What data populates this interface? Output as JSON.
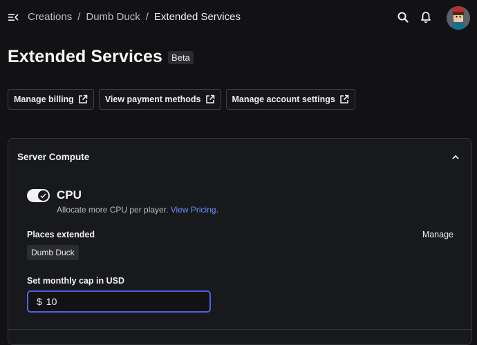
{
  "breadcrumb": {
    "items": [
      "Creations",
      "Dumb Duck",
      "Extended Services"
    ],
    "separator": "/"
  },
  "header": {
    "title": "Extended Services",
    "badge": "Beta"
  },
  "actions": [
    {
      "label": "Manage billing",
      "icon": "external-link-icon"
    },
    {
      "label": "View payment methods",
      "icon": "external-link-icon"
    },
    {
      "label": "Manage account settings",
      "icon": "external-link-icon"
    }
  ],
  "server_compute": {
    "title": "Server Compute",
    "cpu": {
      "title": "CPU",
      "enabled": true,
      "description": "Allocate more CPU per player.",
      "pricing_link": "View Pricing",
      "pricing_suffix": "."
    },
    "places": {
      "label": "Places extended",
      "manage_label": "Manage",
      "items": [
        "Dumb Duck"
      ]
    },
    "cap": {
      "label": "Set monthly cap in USD",
      "prefix": "$",
      "value": "10"
    }
  },
  "colors": {
    "accent": "#4d63e6",
    "link": "#6a8df5",
    "background": "#121215"
  }
}
